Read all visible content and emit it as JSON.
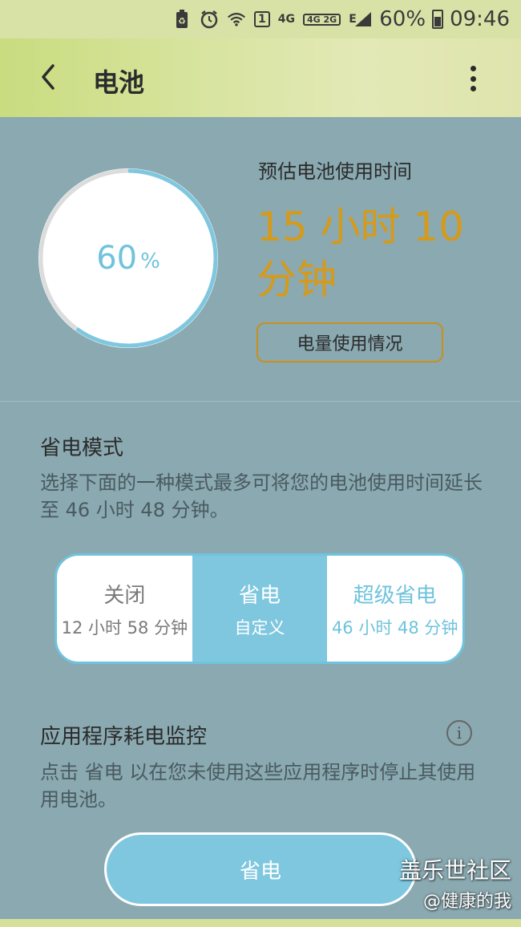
{
  "status_bar": {
    "sim_label": "1",
    "net_4g": "4G",
    "net_4g_2g": "4G 2G",
    "net_e": "E",
    "battery_percent": "60%",
    "time": "09:46"
  },
  "app_bar": {
    "title": "电池"
  },
  "battery": {
    "level_fraction": 0.6,
    "percent_value": "60",
    "percent_sign": "%",
    "estimate_label": "预估电池使用时间",
    "estimate_time": "15 小时 10 分钟",
    "usage_button_label": "电量使用情况"
  },
  "power_saving": {
    "title": "省电模式",
    "description": "选择下面的一种模式最多可将您的电池使用时间延长至 46 小时 48 分钟。",
    "modes": [
      {
        "title": "关闭",
        "subtitle": "12 小时 58 分钟"
      },
      {
        "title": "省电",
        "subtitle": "自定义"
      },
      {
        "title": "超级省电",
        "subtitle": "46 小时 48 分钟"
      }
    ],
    "selected_mode": "省电"
  },
  "app_monitor": {
    "title": "应用程序耗电监控",
    "description": "点击 省电 以在您未使用这些应用程序时停止其使用用电池。",
    "info_icon": "i",
    "save_button_label": "省电"
  },
  "watermark": {
    "line1": "盖乐世社区",
    "line2": "@健康的我"
  },
  "colors": {
    "background": "#8aa9b1",
    "accent_blue": "#7ec7df",
    "accent_orange": "#d69a1a"
  }
}
